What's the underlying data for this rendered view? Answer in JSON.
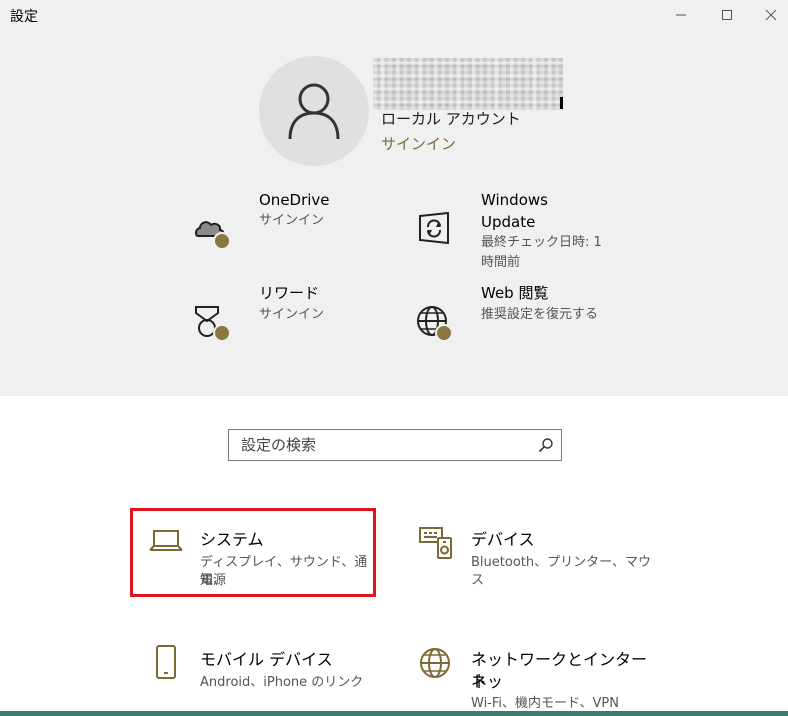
{
  "window": {
    "title": "設定"
  },
  "account": {
    "type": "ローカル アカウント",
    "signin_link": "サインイン"
  },
  "quick_links": [
    {
      "title": "OneDrive",
      "subtitle": "サインイン",
      "icon": "cloud-icon"
    },
    {
      "title": "Windows Update",
      "title_line1": "Windows",
      "title_line2": "Update",
      "subtitle": "最終チェック日時: 1 時間前",
      "subtitle_line1": "最終チェック日時: 1",
      "subtitle_line2": "時間前",
      "icon": "sync-icon"
    },
    {
      "title": "リワード",
      "subtitle": "サインイン",
      "icon": "medal-icon"
    },
    {
      "title": "Web 閲覧",
      "subtitle": "推奨設定を復元する",
      "icon": "globe-icon"
    }
  ],
  "search": {
    "placeholder": "設定の検索"
  },
  "categories": [
    {
      "title": "システム",
      "desc_line1": "ディスプレイ、サウンド、通知、",
      "desc_line2": "電源",
      "icon": "laptop-icon"
    },
    {
      "title": "デバイス",
      "desc_line1": "Bluetooth、プリンター、マウス",
      "icon": "keyboard-printer-icon"
    },
    {
      "title": "モバイル デバイス",
      "desc_line1": "Android、iPhone のリンク",
      "icon": "phone-icon"
    },
    {
      "title_line1": "ネットワークとインターネッ",
      "title_line2": "ト",
      "desc_line1": "Wi-Fi、機内モード、VPN",
      "icon": "globe-network-icon"
    }
  ],
  "colors": {
    "accent": "#7b6a35",
    "badge": "#8a7742",
    "highlight_border": "#e0151b",
    "header_bg": "#f0f0f0"
  }
}
